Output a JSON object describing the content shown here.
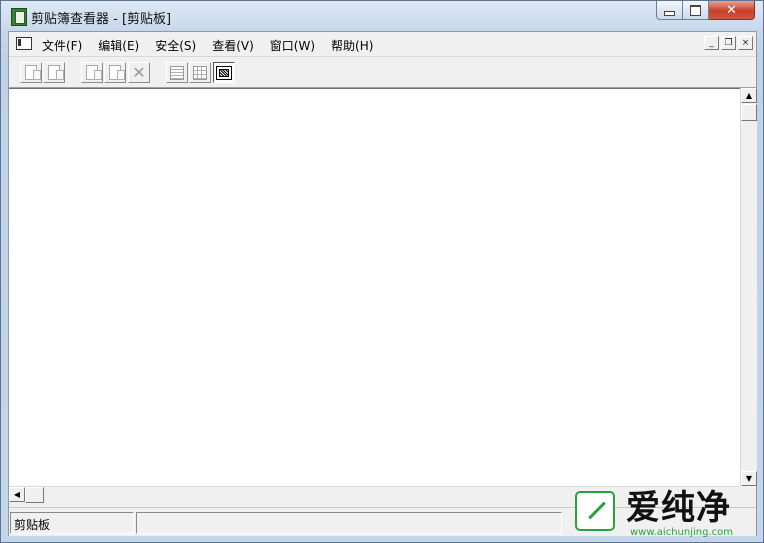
{
  "window": {
    "title": "剪贴簿查看器 - [剪贴板]",
    "caption_buttons": {
      "minimize": "minimize",
      "maximize": "maximize",
      "close": "✕"
    }
  },
  "menubar": {
    "items": [
      {
        "label": "文件(F)"
      },
      {
        "label": "编辑(E)"
      },
      {
        "label": "安全(S)"
      },
      {
        "label": "查看(V)"
      },
      {
        "label": "窗口(W)"
      },
      {
        "label": "帮助(H)"
      }
    ],
    "mdi_buttons": {
      "minimize": "_",
      "restore": "❐",
      "close": "×"
    }
  },
  "toolbar": {
    "buttons": [
      {
        "icon": "connect-icon",
        "enabled": false
      },
      {
        "icon": "disconnect-icon",
        "enabled": false
      },
      {
        "icon": "copy-icon",
        "enabled": false
      },
      {
        "icon": "paste-icon",
        "enabled": false
      },
      {
        "icon": "delete-icon",
        "enabled": false
      },
      {
        "icon": "list-view-icon",
        "enabled": false
      },
      {
        "icon": "thumbnail-view-icon",
        "enabled": false
      },
      {
        "icon": "full-view-icon",
        "enabled": true,
        "pressed": true
      }
    ]
  },
  "scroll": {
    "up_arrow": "▲",
    "down_arrow": "▼",
    "left_arrow": "◀"
  },
  "statusbar": {
    "pane1": "剪贴板",
    "pane2": ""
  },
  "watermark": {
    "title": "爱纯净",
    "url": "www.aichunjing.com"
  },
  "colors": {
    "close_button": "#c7402a",
    "watermark_green": "#27a33b",
    "window_frame": "#bfd1e6"
  }
}
